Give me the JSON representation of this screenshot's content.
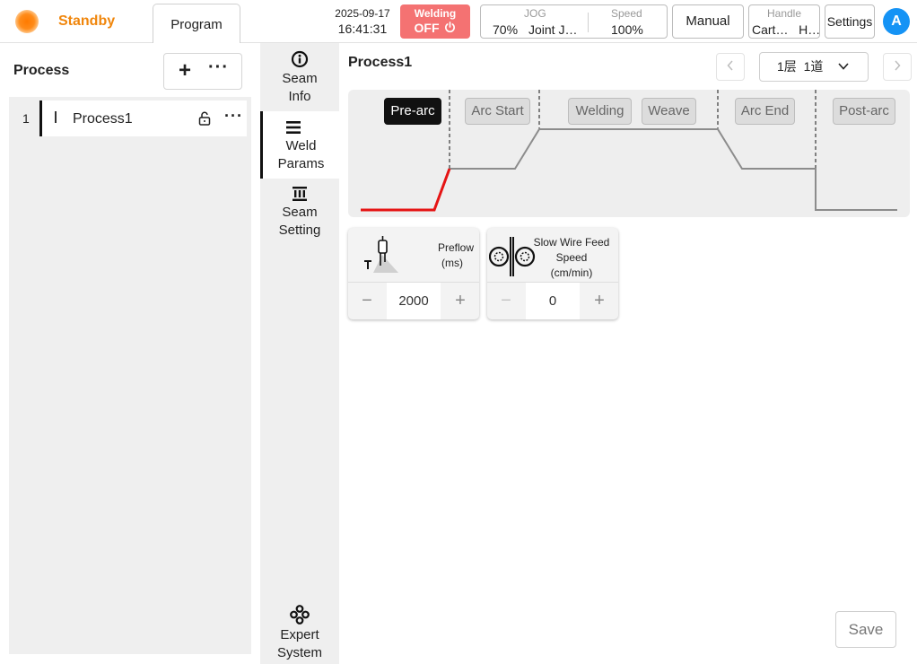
{
  "header": {
    "status": "Standby",
    "tab_program": "Program",
    "date": "2025-09-17",
    "time": "16:41:31",
    "welding_label": "Welding",
    "welding_state": "OFF",
    "jog_label": "JOG",
    "jog_percent": "70%",
    "jog_mode": "Joint J…",
    "speed_label": "Speed",
    "speed_value": "100%",
    "manual": "Manual",
    "handle_label": "Handle",
    "handle_value": "Cart…   H…",
    "settings": "Settings",
    "avatar": "A",
    "status_color": "#f0860c",
    "welding_color": "#f47272",
    "avatar_color": "#1593f5"
  },
  "sidebar": {
    "title": "Process",
    "items": [
      {
        "index": "1",
        "label": "Process1"
      }
    ]
  },
  "nav": {
    "items": [
      {
        "label_1": "Seam",
        "label_2": "Info",
        "icon": "info-icon"
      },
      {
        "label_1": "Weld",
        "label_2": "Params",
        "icon": "list-icon",
        "active": true
      },
      {
        "label_1": "Seam",
        "label_2": "Setting",
        "icon": "seam-setting-icon"
      },
      {
        "label_1": "Expert",
        "label_2": "System",
        "icon": "expert-system-icon"
      }
    ]
  },
  "main": {
    "title": "Process1",
    "layer_select": "1层  1道",
    "stages": [
      "Pre-arc",
      "Arc Start",
      "Welding",
      "Weave",
      "Arc End",
      "Post-arc"
    ],
    "active_stage": "Pre-arc",
    "params": [
      {
        "label_1": "Preflow",
        "label_2": "(ms)",
        "value": "2000",
        "icon": "torch-gas-icon"
      },
      {
        "label_1": "Slow Wire Feed",
        "label_2": "Speed",
        "label_3": "(cm/min)",
        "value": "0",
        "icon": "wire-feed-rollers-icon"
      }
    ],
    "save": "Save"
  }
}
